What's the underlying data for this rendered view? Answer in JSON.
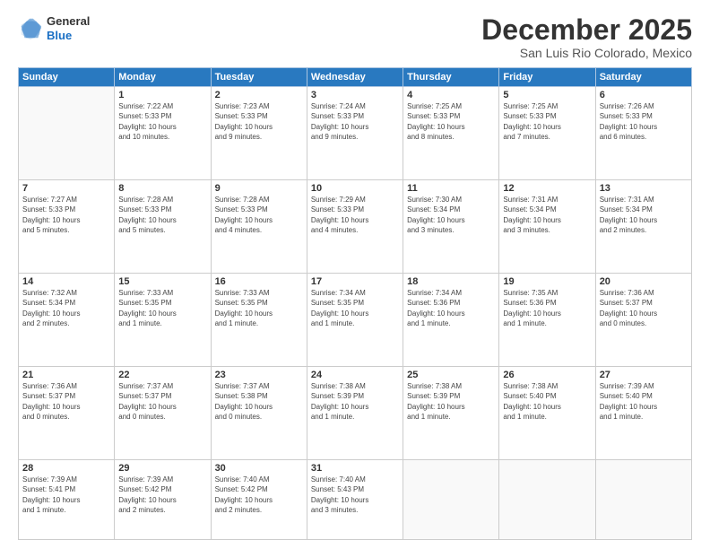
{
  "logo": {
    "general": "General",
    "blue": "Blue"
  },
  "header": {
    "month": "December 2025",
    "location": "San Luis Rio Colorado, Mexico"
  },
  "weekdays": [
    "Sunday",
    "Monday",
    "Tuesday",
    "Wednesday",
    "Thursday",
    "Friday",
    "Saturday"
  ],
  "weeks": [
    [
      {
        "day": "",
        "info": ""
      },
      {
        "day": "1",
        "info": "Sunrise: 7:22 AM\nSunset: 5:33 PM\nDaylight: 10 hours\nand 10 minutes."
      },
      {
        "day": "2",
        "info": "Sunrise: 7:23 AM\nSunset: 5:33 PM\nDaylight: 10 hours\nand 9 minutes."
      },
      {
        "day": "3",
        "info": "Sunrise: 7:24 AM\nSunset: 5:33 PM\nDaylight: 10 hours\nand 9 minutes."
      },
      {
        "day": "4",
        "info": "Sunrise: 7:25 AM\nSunset: 5:33 PM\nDaylight: 10 hours\nand 8 minutes."
      },
      {
        "day": "5",
        "info": "Sunrise: 7:25 AM\nSunset: 5:33 PM\nDaylight: 10 hours\nand 7 minutes."
      },
      {
        "day": "6",
        "info": "Sunrise: 7:26 AM\nSunset: 5:33 PM\nDaylight: 10 hours\nand 6 minutes."
      }
    ],
    [
      {
        "day": "7",
        "info": "Sunrise: 7:27 AM\nSunset: 5:33 PM\nDaylight: 10 hours\nand 5 minutes."
      },
      {
        "day": "8",
        "info": "Sunrise: 7:28 AM\nSunset: 5:33 PM\nDaylight: 10 hours\nand 5 minutes."
      },
      {
        "day": "9",
        "info": "Sunrise: 7:28 AM\nSunset: 5:33 PM\nDaylight: 10 hours\nand 4 minutes."
      },
      {
        "day": "10",
        "info": "Sunrise: 7:29 AM\nSunset: 5:33 PM\nDaylight: 10 hours\nand 4 minutes."
      },
      {
        "day": "11",
        "info": "Sunrise: 7:30 AM\nSunset: 5:34 PM\nDaylight: 10 hours\nand 3 minutes."
      },
      {
        "day": "12",
        "info": "Sunrise: 7:31 AM\nSunset: 5:34 PM\nDaylight: 10 hours\nand 3 minutes."
      },
      {
        "day": "13",
        "info": "Sunrise: 7:31 AM\nSunset: 5:34 PM\nDaylight: 10 hours\nand 2 minutes."
      }
    ],
    [
      {
        "day": "14",
        "info": "Sunrise: 7:32 AM\nSunset: 5:34 PM\nDaylight: 10 hours\nand 2 minutes."
      },
      {
        "day": "15",
        "info": "Sunrise: 7:33 AM\nSunset: 5:35 PM\nDaylight: 10 hours\nand 1 minute."
      },
      {
        "day": "16",
        "info": "Sunrise: 7:33 AM\nSunset: 5:35 PM\nDaylight: 10 hours\nand 1 minute."
      },
      {
        "day": "17",
        "info": "Sunrise: 7:34 AM\nSunset: 5:35 PM\nDaylight: 10 hours\nand 1 minute."
      },
      {
        "day": "18",
        "info": "Sunrise: 7:34 AM\nSunset: 5:36 PM\nDaylight: 10 hours\nand 1 minute."
      },
      {
        "day": "19",
        "info": "Sunrise: 7:35 AM\nSunset: 5:36 PM\nDaylight: 10 hours\nand 1 minute."
      },
      {
        "day": "20",
        "info": "Sunrise: 7:36 AM\nSunset: 5:37 PM\nDaylight: 10 hours\nand 0 minutes."
      }
    ],
    [
      {
        "day": "21",
        "info": "Sunrise: 7:36 AM\nSunset: 5:37 PM\nDaylight: 10 hours\nand 0 minutes."
      },
      {
        "day": "22",
        "info": "Sunrise: 7:37 AM\nSunset: 5:37 PM\nDaylight: 10 hours\nand 0 minutes."
      },
      {
        "day": "23",
        "info": "Sunrise: 7:37 AM\nSunset: 5:38 PM\nDaylight: 10 hours\nand 0 minutes."
      },
      {
        "day": "24",
        "info": "Sunrise: 7:38 AM\nSunset: 5:39 PM\nDaylight: 10 hours\nand 1 minute."
      },
      {
        "day": "25",
        "info": "Sunrise: 7:38 AM\nSunset: 5:39 PM\nDaylight: 10 hours\nand 1 minute."
      },
      {
        "day": "26",
        "info": "Sunrise: 7:38 AM\nSunset: 5:40 PM\nDaylight: 10 hours\nand 1 minute."
      },
      {
        "day": "27",
        "info": "Sunrise: 7:39 AM\nSunset: 5:40 PM\nDaylight: 10 hours\nand 1 minute."
      }
    ],
    [
      {
        "day": "28",
        "info": "Sunrise: 7:39 AM\nSunset: 5:41 PM\nDaylight: 10 hours\nand 1 minute."
      },
      {
        "day": "29",
        "info": "Sunrise: 7:39 AM\nSunset: 5:42 PM\nDaylight: 10 hours\nand 2 minutes."
      },
      {
        "day": "30",
        "info": "Sunrise: 7:40 AM\nSunset: 5:42 PM\nDaylight: 10 hours\nand 2 minutes."
      },
      {
        "day": "31",
        "info": "Sunrise: 7:40 AM\nSunset: 5:43 PM\nDaylight: 10 hours\nand 3 minutes."
      },
      {
        "day": "",
        "info": ""
      },
      {
        "day": "",
        "info": ""
      },
      {
        "day": "",
        "info": ""
      }
    ]
  ]
}
